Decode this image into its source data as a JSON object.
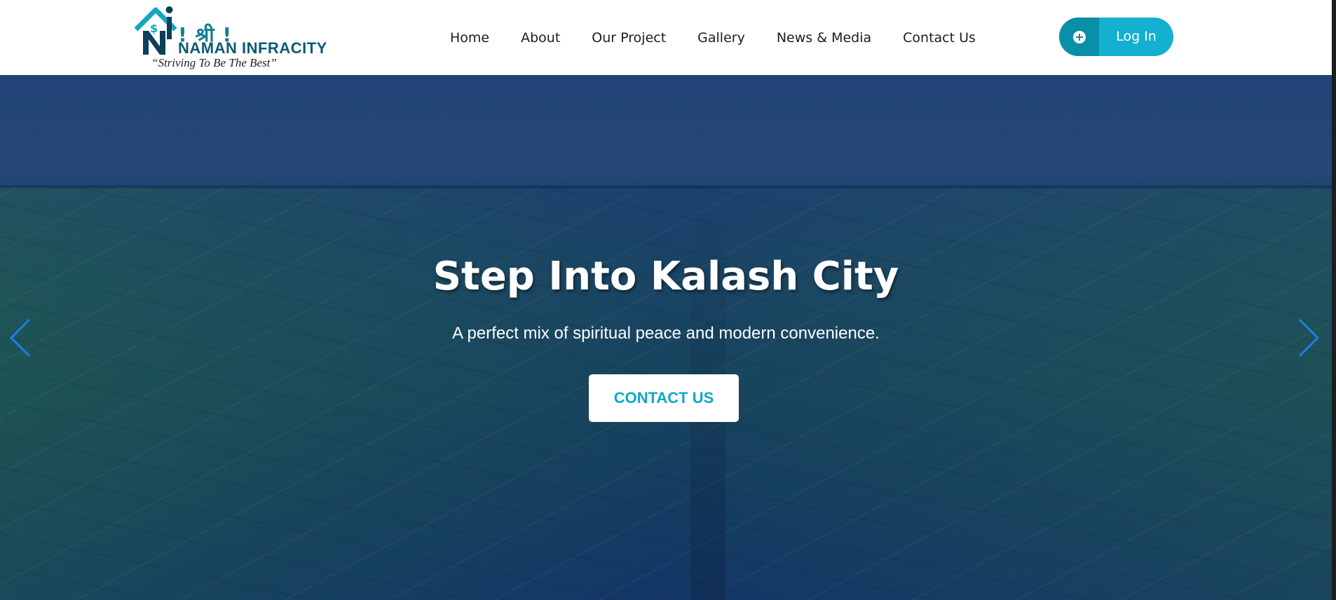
{
  "logo": {
    "shri": "! श्री !",
    "name": "NAMAN INFRACITY",
    "tagline": "“Striving To Be The Best”"
  },
  "nav": {
    "items": [
      "Home",
      "About",
      "Our Project",
      "Gallery",
      "News & Media",
      "Contact Us"
    ]
  },
  "login": {
    "label": "Log In",
    "icon": "plus-circle-icon"
  },
  "hero": {
    "title": "Step Into Kalash City",
    "subtitle": "A perfect mix of spiritual peace and modern convenience.",
    "cta_label": "CONTACT US",
    "prev_icon": "chevron-left-icon",
    "next_icon": "chevron-right-icon"
  },
  "colors": {
    "accent": "#13b0cf",
    "accent_dark": "#0a8fa8",
    "logo_text": "#0b5a74",
    "arrow": "#1e7fe6"
  }
}
